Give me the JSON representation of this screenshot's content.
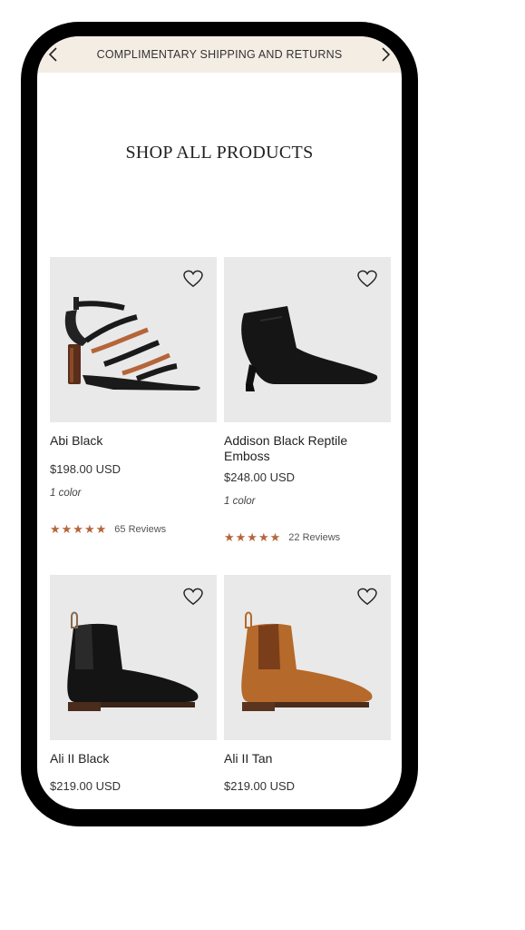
{
  "promo_bar": {
    "text": "COMPLIMENTARY SHIPPING AND RETURNS"
  },
  "page": {
    "title": "SHOP ALL PRODUCTS"
  },
  "products": [
    {
      "name": "Abi Black",
      "price": "$198.00 USD",
      "colors": "1 color",
      "stars": "★★★★★",
      "reviews": "65 Reviews",
      "rating": 5
    },
    {
      "name": "Addison Black Reptile Emboss",
      "price": "$248.00 USD",
      "colors": "1 color",
      "stars": "★★★★★",
      "reviews": "22 Reviews",
      "rating": 5
    },
    {
      "name": "Ali II Black",
      "price": "$219.00 USD"
    },
    {
      "name": "Ali II Tan",
      "price": "$219.00 USD"
    }
  ],
  "colors": {
    "promo_bg": "#f4ede4",
    "star": "#b5653a",
    "card_bg": "#e9e9e9",
    "tan_leather": "#b5692a"
  },
  "icons": [
    "chevron-left-icon",
    "chevron-right-icon",
    "heart-icon"
  ]
}
